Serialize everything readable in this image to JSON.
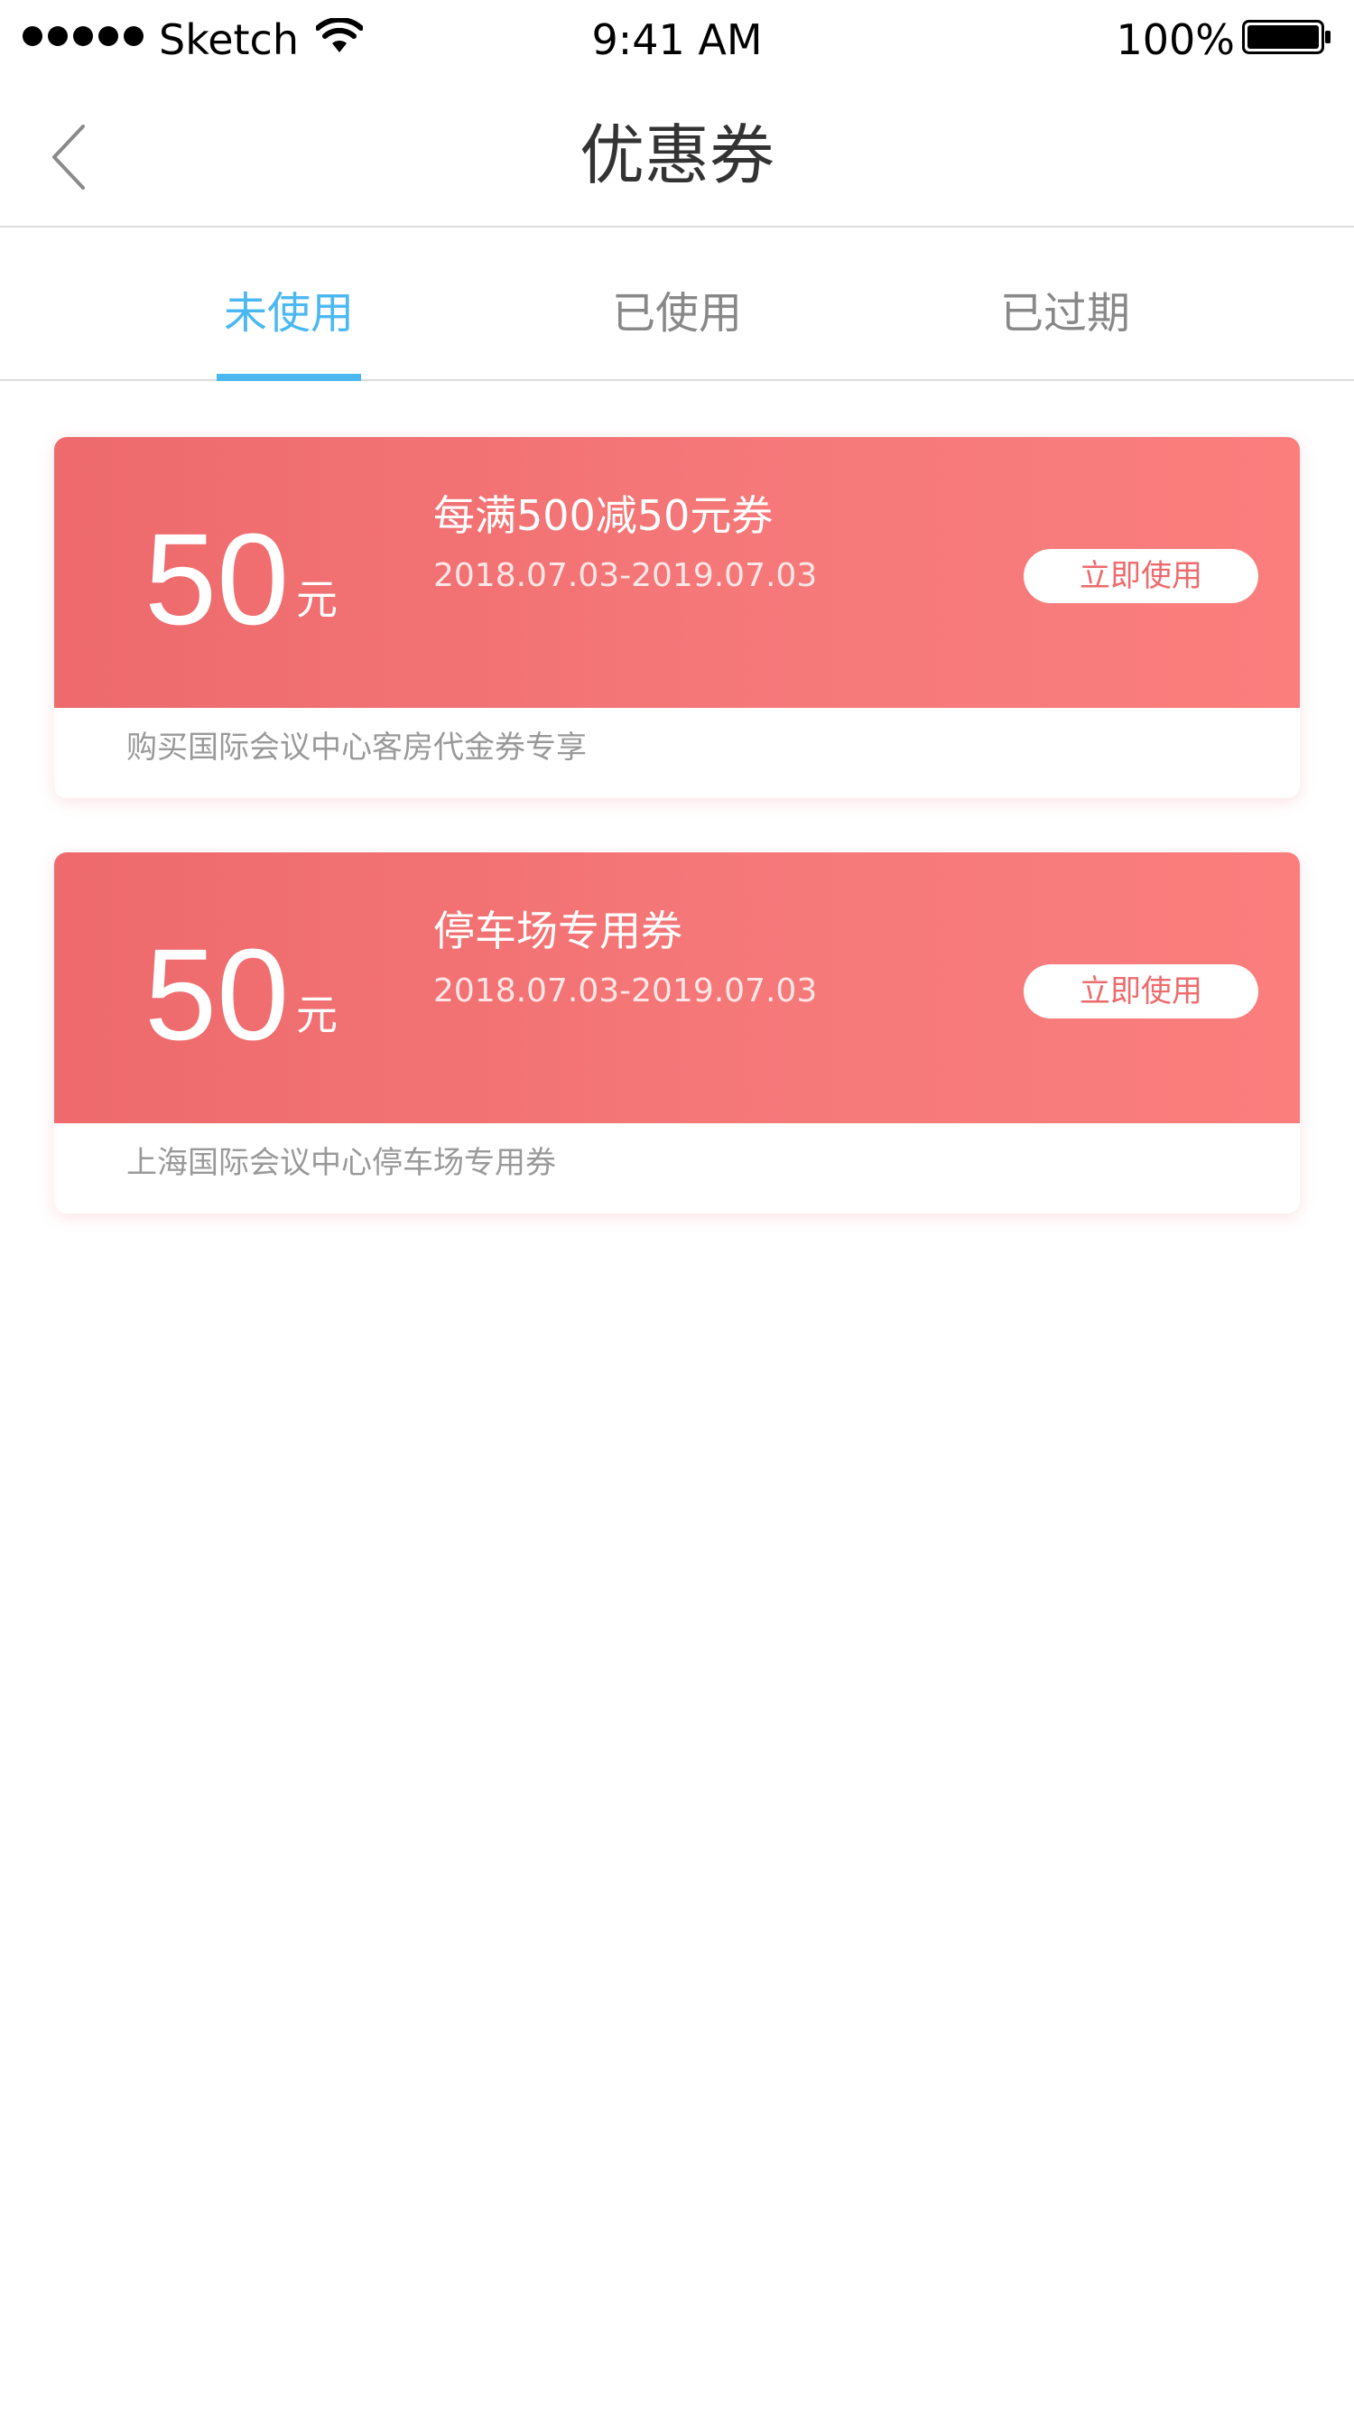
{
  "status_bar": {
    "carrier": "Sketch",
    "time": "9:41 AM",
    "battery": "100%"
  },
  "nav": {
    "title": "优惠券"
  },
  "tabs": [
    {
      "label": "未使用"
    },
    {
      "label": "已使用"
    },
    {
      "label": "已过期"
    }
  ],
  "active_tab": "未使用",
  "coupons": [
    {
      "amount": "50",
      "currency": "元",
      "name": "每满500减50元券",
      "dates": "2018.07.03-2019.07.03",
      "button": "立即使用",
      "description": "购买国际会议中心客房代金券专享"
    },
    {
      "amount": "50",
      "currency": "元",
      "name": "停车场专用券",
      "dates": "2018.07.03-2019.07.03",
      "button": "立即使用",
      "description": "上海国际会议中心停车场专用券"
    }
  ],
  "colors": {
    "accent": "#4bb8f2",
    "coupon_start": "#ee6a6c",
    "coupon_end": "#fb7e7d"
  }
}
